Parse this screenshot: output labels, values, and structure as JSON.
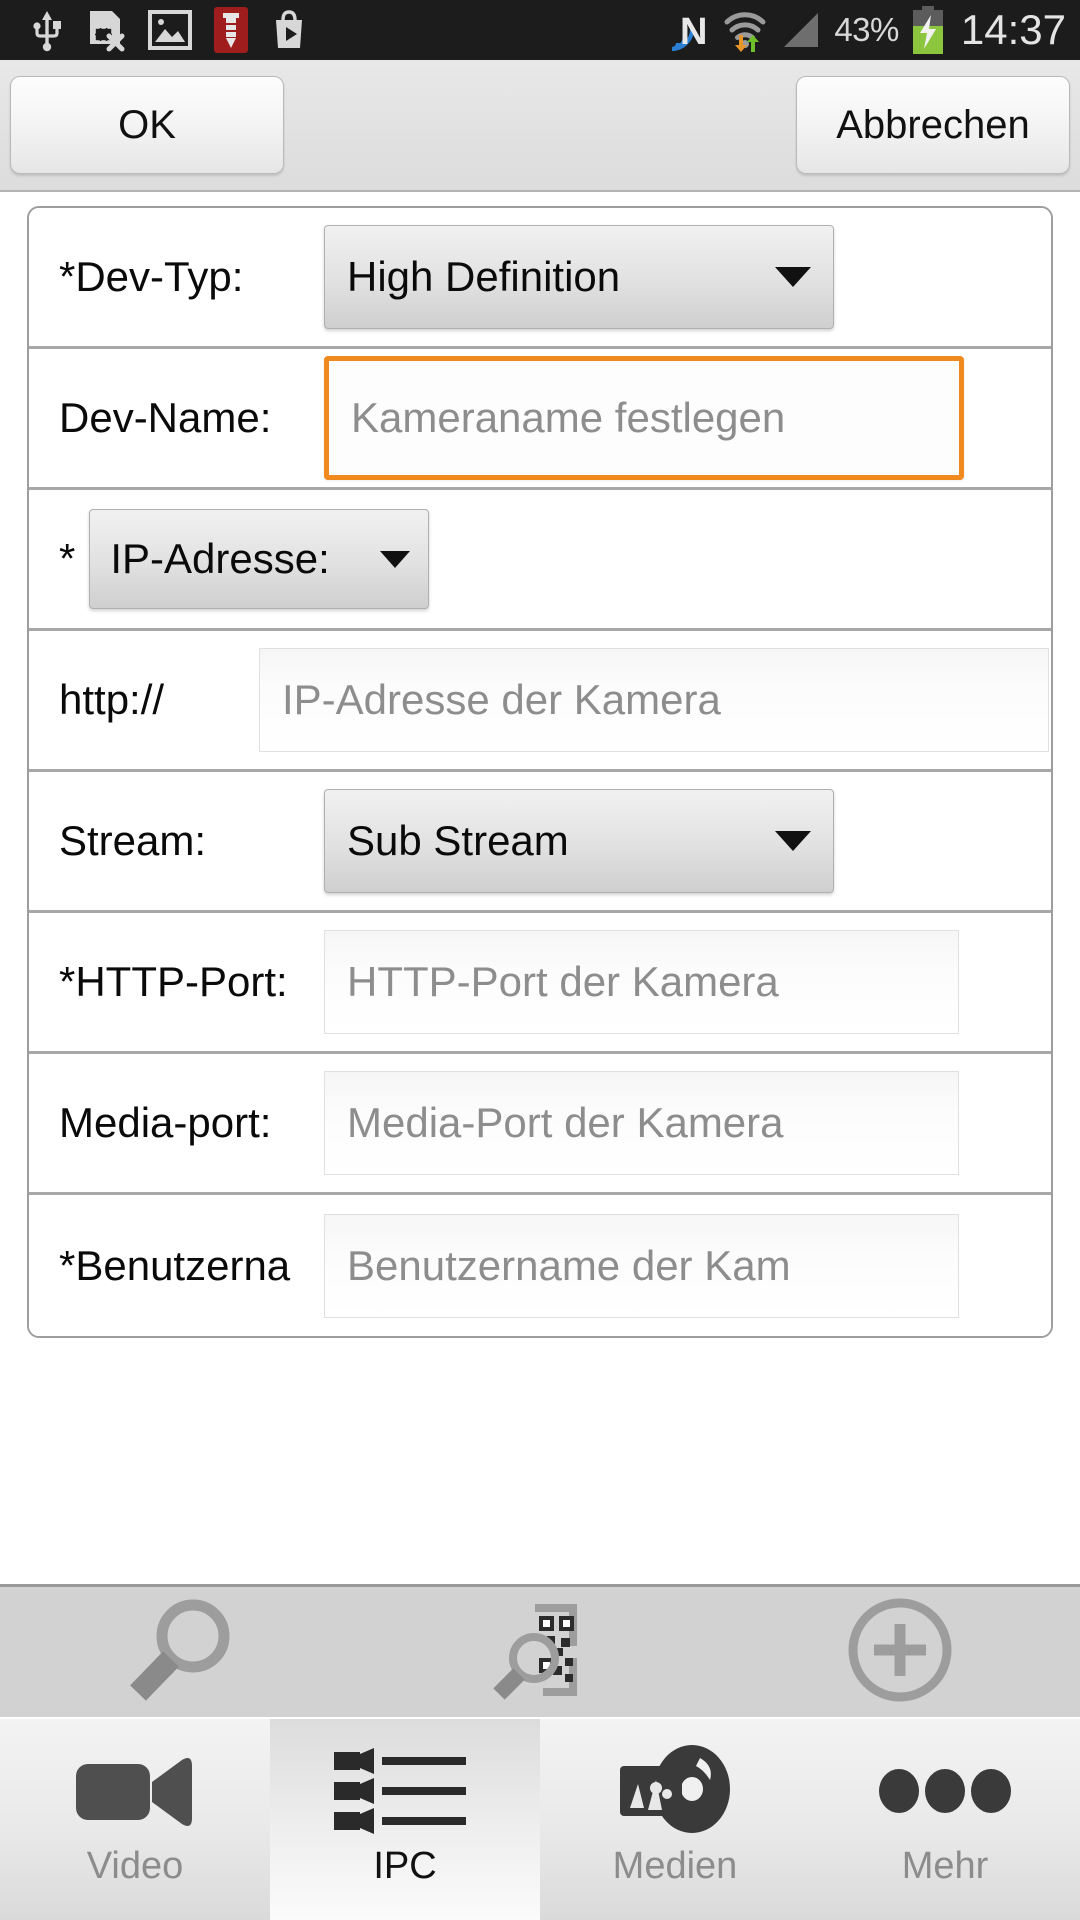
{
  "statusbar": {
    "left_icons": [
      "usb-icon",
      "sim-card-error-icon",
      "screenshot-image-icon",
      "screw-tool-icon",
      "play-store-bag-icon"
    ],
    "right_icons": [
      "nfc-icon",
      "wifi-transfer-icon",
      "cellular-signal-icon"
    ],
    "battery_percent": "43%",
    "battery_state": "charging",
    "clock": "14:37"
  },
  "topbar": {
    "ok_label": "OK",
    "cancel_label": "Abbrechen"
  },
  "form": {
    "rows": [
      {
        "label": "*Dev-Typ:",
        "control": "spinner",
        "value": "High Definition"
      },
      {
        "label": "Dev-Name:",
        "control": "input",
        "value": "",
        "placeholder": "Kameraname festlegen",
        "focused": true
      },
      {
        "label": "*",
        "control": "spinner-small",
        "value": "IP-Adresse:"
      },
      {
        "label": "http://",
        "control": "input",
        "value": "",
        "placeholder": "IP-Adresse der Kamera"
      },
      {
        "label": "Stream:",
        "control": "spinner",
        "value": "Sub Stream"
      },
      {
        "label": "*HTTP-Port:",
        "control": "input",
        "value": "",
        "placeholder": "HTTP-Port der Kamera"
      },
      {
        "label": "Media-port:",
        "control": "input",
        "value": "",
        "placeholder": "Media-Port der Kamera"
      },
      {
        "label": "*Benutzerna",
        "control": "input",
        "value": "",
        "placeholder": "Benutzername der Kam"
      }
    ]
  },
  "toolbar": {
    "items": [
      {
        "icon": "search-icon"
      },
      {
        "icon": "qr-scan-icon"
      },
      {
        "icon": "plus-circle-icon"
      }
    ]
  },
  "tabbar": {
    "tabs": [
      {
        "label": "Video",
        "icon": "video-camera-icon",
        "active": false
      },
      {
        "label": "IPC",
        "icon": "camera-list-icon",
        "active": true
      },
      {
        "label": "Medien",
        "icon": "media-disc-icon",
        "active": false
      },
      {
        "label": "Mehr",
        "icon": "more-dots-icon",
        "active": false
      }
    ]
  },
  "colors": {
    "focus_orange": "#f18a1e",
    "statusbar_bg": "#1c1c1c",
    "toolbar_bg": "#d2d2d2",
    "battery_green": "#8cc63f"
  }
}
